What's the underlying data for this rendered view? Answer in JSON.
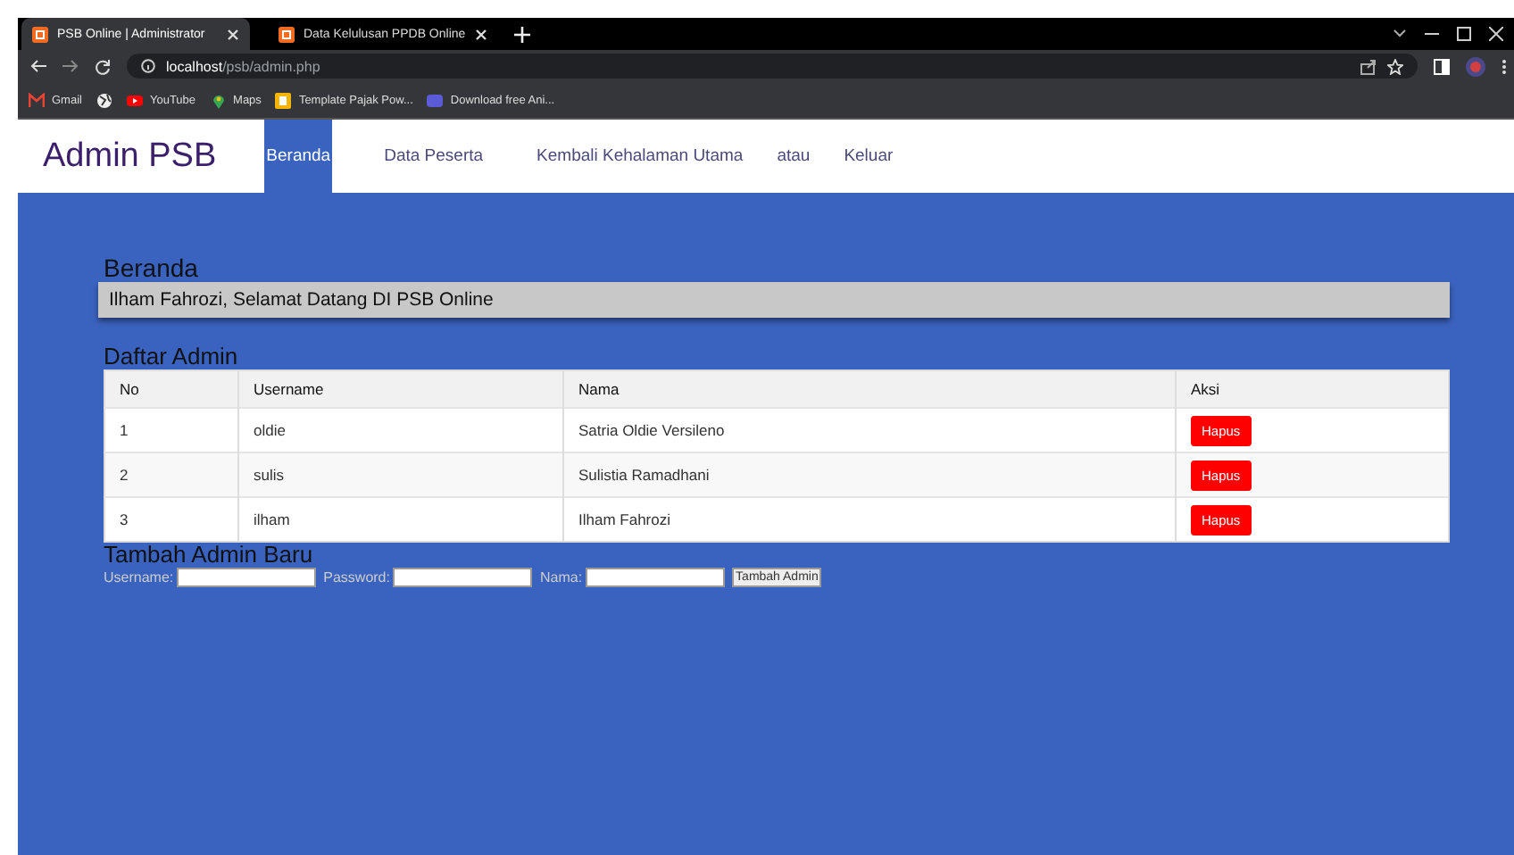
{
  "browser": {
    "tabs": [
      {
        "title": "PSB Online | Administrator",
        "selected": true
      },
      {
        "title": "Data Kelulusan PPDB Online",
        "selected": false
      }
    ],
    "address": {
      "host": "localhost",
      "path": "/psb/admin.php"
    },
    "bookmarks": [
      "Gmail",
      "YouTube",
      "Maps",
      "Template Pajak Pow...",
      "Download free Ani..."
    ]
  },
  "nav": {
    "brand": "Admin PSB",
    "items": [
      {
        "label": "Beranda",
        "kind": "link",
        "selected": true
      },
      {
        "label": "Data Peserta",
        "kind": "link",
        "selected": false
      },
      {
        "label": "Kembali Kehalaman Utama",
        "kind": "link",
        "selected": false
      },
      {
        "label": "atau",
        "kind": "text",
        "selected": false
      },
      {
        "label": "Keluar",
        "kind": "link",
        "selected": false
      }
    ]
  },
  "page_title": "Beranda",
  "welcome": "Ilham Fahrozi, Selamat Datang DI PSB Online",
  "admin_list": {
    "title": "Daftar Admin",
    "columns": [
      "No",
      "Username",
      "Nama",
      "Aksi"
    ],
    "rows": [
      {
        "no": "1",
        "username": "oldie",
        "nama": "Satria Oldie Versileno",
        "action": "Hapus"
      },
      {
        "no": "2",
        "username": "sulis",
        "nama": "Sulistia Ramadhani",
        "action": "Hapus"
      },
      {
        "no": "3",
        "username": "ilham",
        "nama": "Ilham Fahrozi",
        "action": "Hapus"
      }
    ]
  },
  "add_form": {
    "title": "Tambah Admin Baru",
    "fields": [
      {
        "label": "Username:"
      },
      {
        "label": "Password:"
      },
      {
        "label": "Nama:"
      }
    ],
    "submit": "Tambah Admin"
  }
}
